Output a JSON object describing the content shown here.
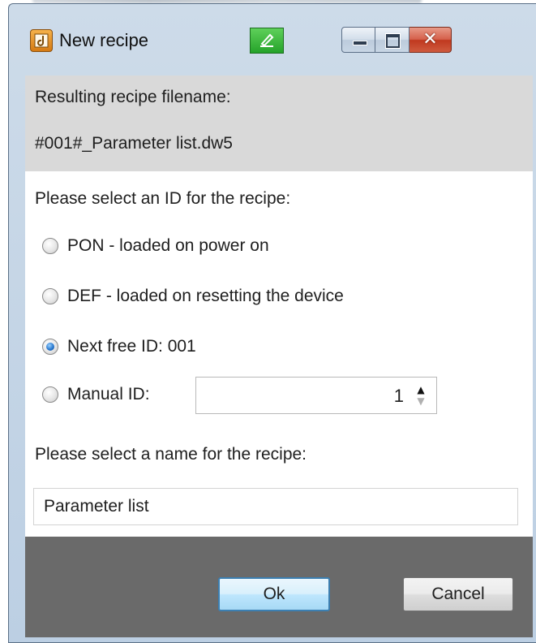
{
  "window": {
    "title": "New recipe",
    "icons": {
      "app": "recipe-app-icon",
      "pin": "pin-edit-icon"
    },
    "controls": {
      "minimize": "minimize-icon",
      "maximize": "maximize-icon",
      "close_glyph": "✕"
    }
  },
  "info": {
    "filename_label": "Resulting recipe filename:",
    "filename_value": "#001#_Parameter list.dw5"
  },
  "id_section": {
    "prompt": "Please select an ID for the recipe:",
    "options": [
      {
        "label": "PON - loaded on power on",
        "checked": false
      },
      {
        "label": "DEF - loaded on resetting the device",
        "checked": false
      },
      {
        "label": "Next free ID: 001",
        "checked": true
      },
      {
        "label": "Manual ID:",
        "checked": false
      }
    ],
    "manual_id_value": "1",
    "spin_up_glyph": "▲",
    "spin_down_glyph": "▼"
  },
  "name_section": {
    "prompt": "Please select a name for the recipe:",
    "value": "Parameter list"
  },
  "buttons": {
    "ok": "Ok",
    "cancel": "Cancel"
  },
  "colors": {
    "info_panel_bg": "#d9d9d9",
    "footer_bg": "#6a6a6a",
    "pin_green": "#2fb02f",
    "close_red": "#c7412a",
    "default_button_border": "#3c7fb1"
  }
}
